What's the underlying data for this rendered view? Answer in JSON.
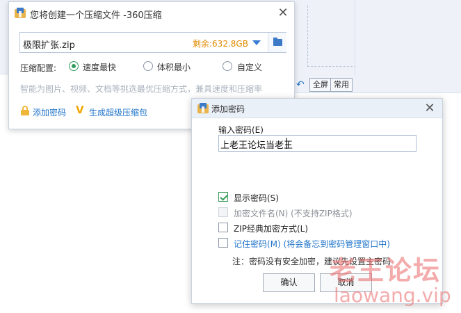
{
  "background": {
    "toolbar": {
      "back_icon": "undo-arrow-icon",
      "btn_fullscreen": "全屏",
      "btn_common": "常用"
    }
  },
  "dialog_create": {
    "title": "您将创建一个压缩文件 -360压缩",
    "filename": "极限扩张.zip",
    "remaining": "剩余:632.8GB",
    "compression_label": "压缩配置:",
    "options": [
      {
        "label": "速度最快",
        "selected": true
      },
      {
        "label": "体积最小",
        "selected": false
      },
      {
        "label": "自定义",
        "selected": false
      }
    ],
    "hint": "智能为图片、视频、文档等挑选最优压缩方式，兼具速度和压缩率",
    "add_password": "添加密码",
    "super_compress": "生成超级压缩包"
  },
  "dialog_password": {
    "title": "添加密码",
    "input_label": "输入密码(E)",
    "input_value": "上老王论坛当老王",
    "checkboxes": [
      {
        "label": "显示密码(S)",
        "checked": true,
        "disabled": false,
        "style": "normal"
      },
      {
        "label": "加密文件名(N) (不支持ZIP格式)",
        "checked": false,
        "disabled": true,
        "style": "dim"
      },
      {
        "label": "ZIP经典加密方式(L)",
        "checked": false,
        "disabled": false,
        "style": "normal"
      },
      {
        "label": "记住密码(M) (将会备忘到密码管理窗口中)",
        "checked": false,
        "disabled": false,
        "style": "blue"
      }
    ],
    "note": "注：密码没有安全加密，建议先设置主密码",
    "ok": "确认",
    "cancel": "取消"
  },
  "watermark": {
    "line1": "老王论坛",
    "line2": "laowang.vip"
  },
  "colors": {
    "accent_blue": "#1f73c9",
    "remaining_orange": "#e08a00",
    "radio_green": "#2f9c5a",
    "watermark_red": "#e96666"
  }
}
